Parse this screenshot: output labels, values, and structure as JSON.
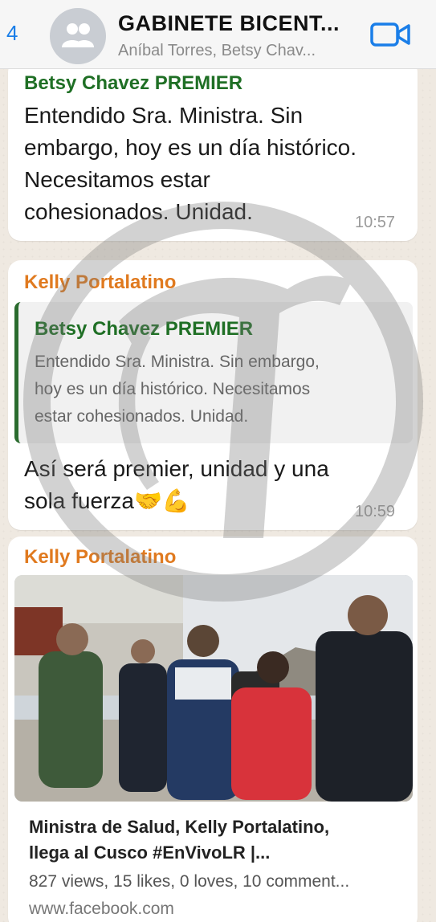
{
  "header": {
    "back_count": "4",
    "title": "GABINETE BICENT...",
    "subtitle": "Aníbal Torres, Betsy Chav..."
  },
  "messages": [
    {
      "sender": "Betsy Chavez PREMIER",
      "lines": [
        "Entendido Sra. Ministra. Sin",
        "embargo, hoy es un día histórico.",
        "Necesitamos estar",
        "cohesionados. Unidad."
      ],
      "time": "10:57"
    },
    {
      "sender": "Kelly Portalatino",
      "quote": {
        "sender": "Betsy Chavez PREMIER",
        "lines": [
          "Entendido Sra. Ministra. Sin embargo,",
          "hoy es un día histórico. Necesitamos",
          "estar cohesionados. Unidad."
        ]
      },
      "lines": [
        "Así será premier, unidad y una",
        "sola fuerza🤝💪"
      ],
      "time": "10:59"
    },
    {
      "sender": "Kelly Portalatino",
      "link": {
        "title_lines": [
          "Ministra de Salud, Kelly Portalatino,",
          "llega al Cusco #EnVivoLR |..."
        ],
        "meta": "827 views, 15 likes, 0 loves, 10 comment...",
        "url": "www.facebook.com"
      }
    }
  ],
  "colors": {
    "accent_blue": "#1a7ee8",
    "sender_green": "#1f6f25",
    "sender_orange": "#e07a1f"
  }
}
